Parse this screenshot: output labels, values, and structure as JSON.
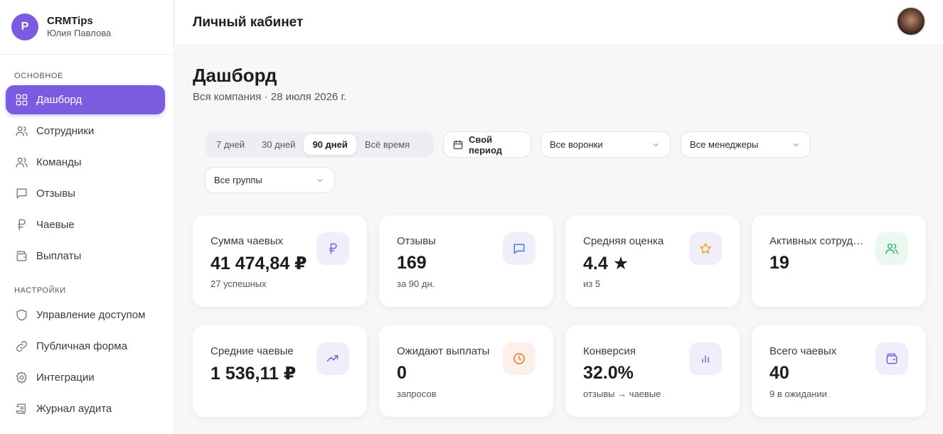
{
  "brand": {
    "initial": "Р",
    "name": "CRMTips",
    "user": "Юлия Павлова"
  },
  "header": {
    "title": "Личный кабинет"
  },
  "sidebar": {
    "section_main": "ОСНОВНОЕ",
    "section_settings": "НАСТРОЙКИ",
    "items": [
      {
        "label": "Дашборд",
        "icon": "dashboard-icon"
      },
      {
        "label": "Сотрудники",
        "icon": "users-icon"
      },
      {
        "label": "Команды",
        "icon": "team-icon"
      },
      {
        "label": "Отзывы",
        "icon": "message-icon"
      },
      {
        "label": "Чаевые",
        "icon": "ruble-icon"
      },
      {
        "label": "Выплаты",
        "icon": "wallet-icon"
      },
      {
        "label": "Управление доступом",
        "icon": "shield-icon"
      },
      {
        "label": "Публичная форма",
        "icon": "link-icon"
      },
      {
        "label": "Интеграции",
        "icon": "gear-icon"
      },
      {
        "label": "Журнал аудита",
        "icon": "scroll-icon"
      }
    ]
  },
  "main": {
    "title": "Дашборд",
    "subtitle": "Вся компания · 28 июля 2026 г."
  },
  "filters": {
    "periods": [
      "7 дней",
      "30 дней",
      "90 дней",
      "Всё время"
    ],
    "active_period": "90 дней",
    "custom_period": "Свой период",
    "funnels": "Все воронки",
    "managers": "Все менеджеры",
    "groups": "Все группы"
  },
  "cards": [
    {
      "label": "Сумма чаевых",
      "value": "41 474,84 ₽",
      "sub": "27 успешных",
      "icon": "ruble-icon",
      "icon_color": "#7b5be0"
    },
    {
      "label": "Отзывы",
      "value": "169",
      "sub": "за 90 дн.",
      "icon": "message-icon",
      "icon_color": "#4a7be0"
    },
    {
      "label": "Средняя оценка",
      "value": "4.4 ★",
      "sub": "из 5",
      "icon": "star-icon",
      "icon_color": "#e8a91a"
    },
    {
      "label": "Активных сотрудников",
      "value": "19",
      "sub": "",
      "icon": "users-icon",
      "icon_color": "#2fb36b"
    },
    {
      "label": "Средние чаевые",
      "value": "1 536,11 ₽",
      "sub": "",
      "icon": "trend-up-icon",
      "icon_color": "#7b5be0"
    },
    {
      "label": "Ожидают выплаты",
      "value": "0",
      "sub": "запросов",
      "icon": "clock-icon",
      "icon_color": "#e8742a"
    },
    {
      "label": "Конверсия",
      "value": "32.0%",
      "sub": "отзывы → чаевые",
      "icon": "bar-chart-icon",
      "icon_color": "#8a5be0"
    },
    {
      "label": "Всего чаевых",
      "value": "40",
      "sub": "9 в ожидании",
      "icon": "wallet-icon",
      "icon_color": "#7b5be0"
    }
  ],
  "colors": {
    "accent": "#7b5be0",
    "icon_bg": "#f1eefc"
  }
}
